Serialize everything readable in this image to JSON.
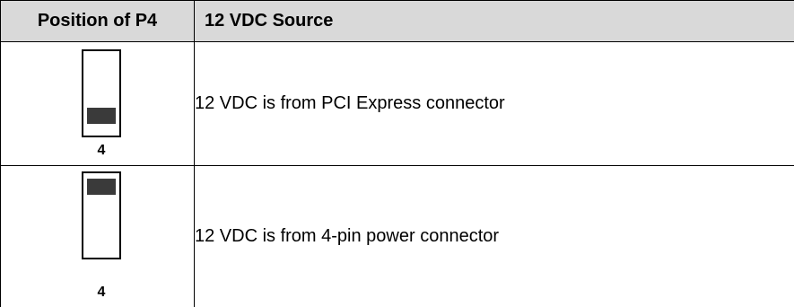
{
  "table": {
    "headers": [
      "Position of P4",
      "12 VDC Source"
    ],
    "rows": [
      {
        "jumper_label": "4",
        "jumper_position": "bottom",
        "source": "12 VDC is from PCI Express connector"
      },
      {
        "jumper_label": "4",
        "jumper_position": "top",
        "source": "12 VDC is from 4-pin power connector"
      }
    ]
  },
  "colors": {
    "header_background": "#d9d9d9",
    "jumper_fill": "#3a3a3a",
    "border": "#000000"
  }
}
